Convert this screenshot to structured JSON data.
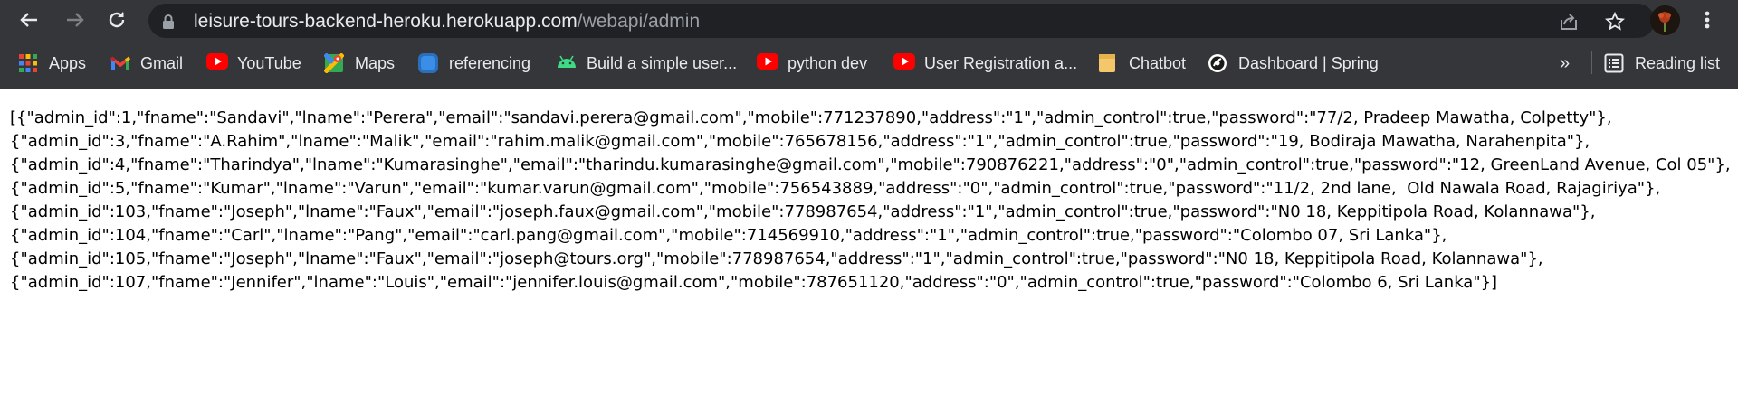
{
  "browser": {
    "url_host": "leisure-tours-backend-heroku.herokuapp.com",
    "url_path": "/webapi/admin",
    "reading_list_label": "Reading list",
    "overflow_label": "»"
  },
  "bookmarks": [
    {
      "label": "Apps",
      "icon": "apps-grid-icon"
    },
    {
      "label": "Gmail",
      "icon": "gmail-icon"
    },
    {
      "label": "YouTube",
      "icon": "youtube-icon"
    },
    {
      "label": "Maps",
      "icon": "maps-icon"
    },
    {
      "label": "referencing",
      "icon": "referencing-icon"
    },
    {
      "label": "Build a simple user...",
      "icon": "android-icon"
    },
    {
      "label": "python dev",
      "icon": "youtube-icon"
    },
    {
      "label": "User Registration a...",
      "icon": "youtube-icon"
    },
    {
      "label": "Chatbot",
      "icon": "folder-icon"
    },
    {
      "label": "Dashboard | Spring",
      "icon": "spring-icon"
    }
  ],
  "json_lines": [
    "[{\"admin_id\":1,\"fname\":\"Sandavi\",\"lname\":\"Perera\",\"email\":\"sandavi.perera@gmail.com\",\"mobile\":771237890,\"address\":\"1\",\"admin_control\":true,\"password\":\"77/2, Pradeep Mawatha, Colpetty\"},",
    "{\"admin_id\":3,\"fname\":\"A.Rahim\",\"lname\":\"Malik\",\"email\":\"rahim.malik@gmail.com\",\"mobile\":765678156,\"address\":\"1\",\"admin_control\":true,\"password\":\"19, Bodiraja Mawatha, Narahenpita\"},",
    "{\"admin_id\":4,\"fname\":\"Tharindya\",\"lname\":\"Kumarasinghe\",\"email\":\"tharindu.kumarasinghe@gmail.com\",\"mobile\":790876221,\"address\":\"0\",\"admin_control\":true,\"password\":\"12, GreenLand Avenue, Col 05\"},",
    "{\"admin_id\":5,\"fname\":\"Kumar\",\"lname\":\"Varun\",\"email\":\"kumar.varun@gmail.com\",\"mobile\":756543889,\"address\":\"0\",\"admin_control\":true,\"password\":\"11/2, 2nd lane,  Old Nawala Road, Rajagiriya\"},",
    "{\"admin_id\":103,\"fname\":\"Joseph\",\"lname\":\"Faux\",\"email\":\"joseph.faux@gmail.com\",\"mobile\":778987654,\"address\":\"1\",\"admin_control\":true,\"password\":\"N0 18, Keppitipola Road, Kolannawa\"},",
    "{\"admin_id\":104,\"fname\":\"Carl\",\"lname\":\"Pang\",\"email\":\"carl.pang@gmail.com\",\"mobile\":714569910,\"address\":\"1\",\"admin_control\":true,\"password\":\"Colombo 07, Sri Lanka\"},",
    "{\"admin_id\":105,\"fname\":\"Joseph\",\"lname\":\"Faux\",\"email\":\"joseph@tours.org\",\"mobile\":778987654,\"address\":\"1\",\"admin_control\":true,\"password\":\"N0 18, Keppitipola Road, Kolannawa\"},",
    "{\"admin_id\":107,\"fname\":\"Jennifer\",\"lname\":\"Louis\",\"email\":\"jennifer.louis@gmail.com\",\"mobile\":787651120,\"address\":\"0\",\"admin_control\":true,\"password\":\"Colombo 6, Sri Lanka\"}]"
  ],
  "colors": {
    "chrome_bg": "#35363a",
    "omnibox_bg": "#202124",
    "text_light": "#e8eaed",
    "text_muted": "#9aa0a6"
  }
}
